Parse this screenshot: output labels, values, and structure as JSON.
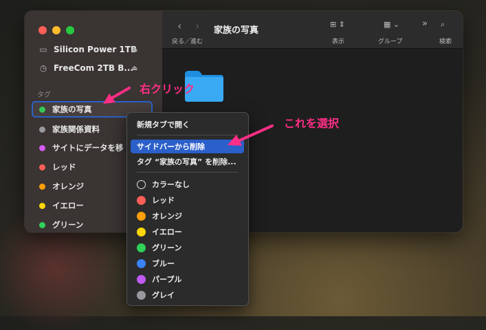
{
  "window": {
    "title": "家族の写真"
  },
  "toolbar": {
    "back_forward_label": "戻る／進む",
    "view_label": "表示",
    "group_label": "グループ",
    "search_label": "検索"
  },
  "sidebar": {
    "devices": [
      {
        "label": "Silicon Power 1TB"
      },
      {
        "label": "FreeCom 2TB B..."
      }
    ],
    "tags_section_label": "タグ",
    "tags": [
      {
        "label": "家族の写真",
        "color": "#34c759"
      },
      {
        "label": "家族関係資料",
        "color": "#98989d"
      },
      {
        "label": "サイトにデータを移",
        "color": "#d45cf3"
      },
      {
        "label": "レッド",
        "color": "#ff5f57"
      },
      {
        "label": "オレンジ",
        "color": "#ff9f0a"
      },
      {
        "label": "イエロー",
        "color": "#ffd60a"
      },
      {
        "label": "グリーン",
        "color": "#30d158"
      }
    ]
  },
  "context_menu": {
    "items": [
      {
        "label": "新規タブで開く"
      },
      {
        "label": "サイドバーから削除"
      },
      {
        "label": "タグ “家族の写真” を削除..."
      }
    ],
    "colors": [
      {
        "label": "カラーなし",
        "color": "none"
      },
      {
        "label": "レッド",
        "color": "#ff5f57"
      },
      {
        "label": "オレンジ",
        "color": "#ff9f0a"
      },
      {
        "label": "イエロー",
        "color": "#ffd60a"
      },
      {
        "label": "グリーン",
        "color": "#30d158"
      },
      {
        "label": "ブルー",
        "color": "#3a82f7"
      },
      {
        "label": "パープル",
        "color": "#bf5af2"
      },
      {
        "label": "グレイ",
        "color": "#98989d"
      }
    ]
  },
  "annotations": {
    "right_click": "右クリック",
    "select_this": "これを選択",
    "color": "#ff2e86"
  }
}
